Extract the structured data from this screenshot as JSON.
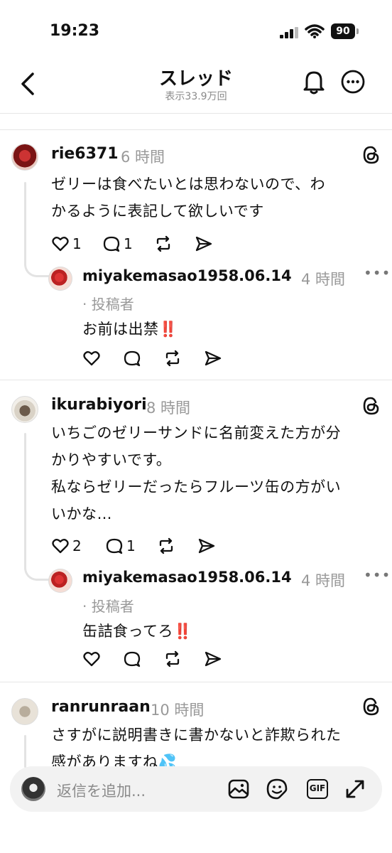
{
  "status_bar": {
    "time": "19:23",
    "battery": "90"
  },
  "header": {
    "title": "スレッド",
    "views": "表示33.9万回"
  },
  "posts": [
    {
      "username": "rie6371",
      "time": "6 時間",
      "text_lines": [
        "ゼリーは食べたいとは思わないので、わ",
        "かるように表記して欲しいです"
      ],
      "likes": "1",
      "replies": "1",
      "reply": {
        "username": "miyakemasao1958.06.14",
        "time": "4 時間",
        "author_tag": "· 投稿者",
        "text": "お前は出禁‼️"
      }
    },
    {
      "username": "ikurabiyori",
      "time": "8 時間",
      "text_lines": [
        "いちごのゼリーサンドに名前変えた方が分",
        "かりやすいです。",
        "私ならゼリーだったらフルーツ缶の方がい",
        "いかな…"
      ],
      "likes": "2",
      "replies": "1",
      "reply": {
        "username": "miyakemasao1958.06.14",
        "time": "4 時間",
        "author_tag": "· 投稿者",
        "text": "缶詰食ってろ‼️"
      }
    },
    {
      "username": "ranrunraan",
      "time": "10 時間",
      "text_lines": [
        "さすがに説明書きに書かないと詐欺られた",
        "感がありますね💦"
      ]
    }
  ],
  "reply_bar": {
    "placeholder": "返信を追加...",
    "gif_label": "GIF"
  },
  "icons": [
    "back-icon",
    "bell-icon",
    "more-icon",
    "threads-logo-icon",
    "heart-icon",
    "comment-icon",
    "repost-icon",
    "share-icon",
    "image-icon",
    "sticker-icon",
    "gif-icon",
    "expand-icon"
  ]
}
